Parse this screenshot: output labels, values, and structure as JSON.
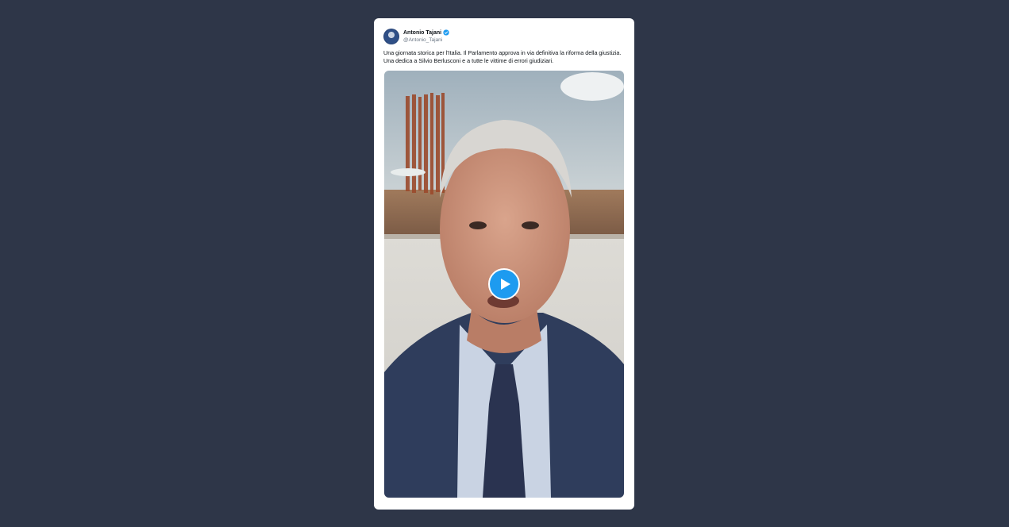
{
  "tweet": {
    "author": {
      "display_name": "Antonio Tajani",
      "handle": "@Antonio_Tajani",
      "verified": true
    },
    "text": "Una giornata storica per l'Italia. Il Parlamento approva in via definitiva la riforma della giustizia. Una dedica a Silvio Berlusconi e a tutte le vittime di errori giudiziari.",
    "media": {
      "type": "video",
      "play_icon": "play-icon"
    }
  },
  "colors": {
    "page_background": "#2e3648",
    "card_background": "#ffffff",
    "accent": "#1d9bf0"
  }
}
